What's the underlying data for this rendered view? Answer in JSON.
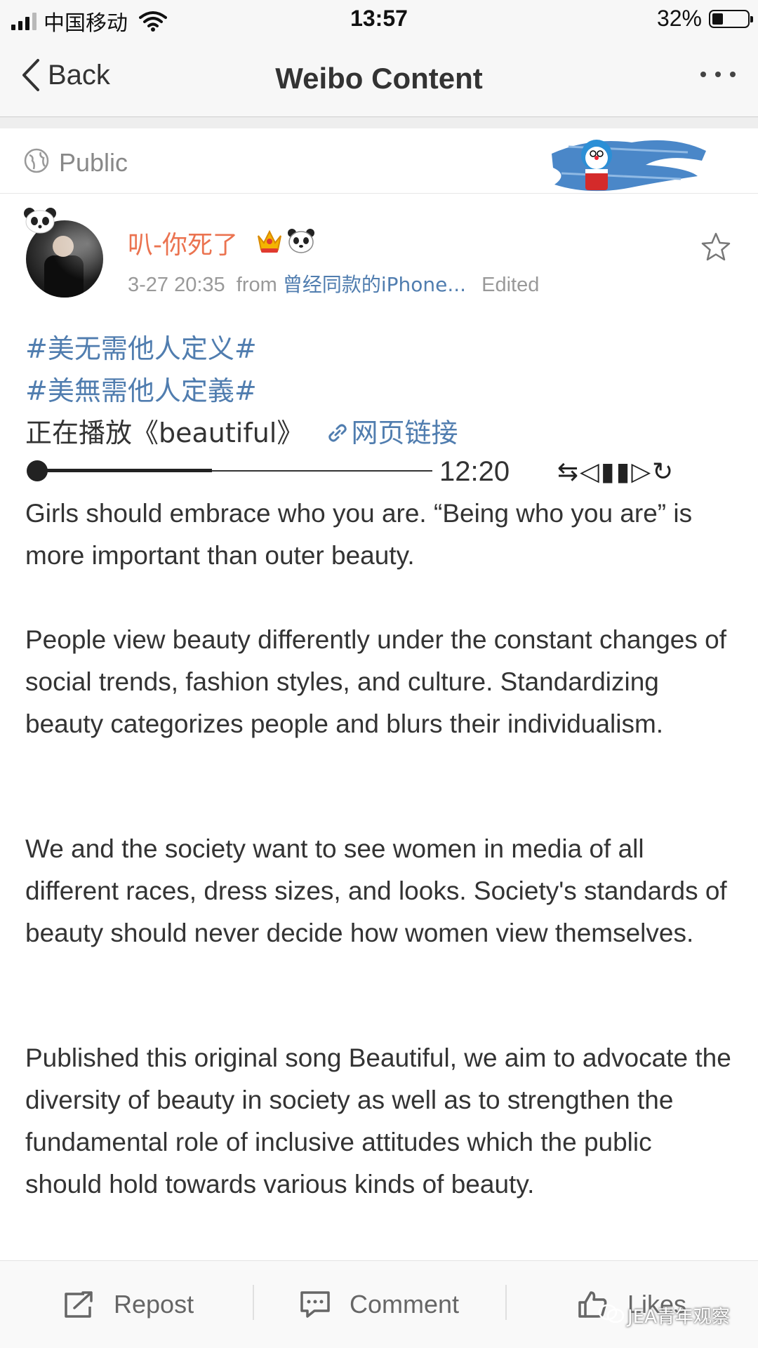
{
  "status_bar": {
    "carrier": "中国移动",
    "time": "13:57",
    "battery_percent": "32%",
    "battery_level": 0.32
  },
  "nav": {
    "back_label": "Back",
    "title": "Weibo Content"
  },
  "visibility": {
    "label": "Public"
  },
  "post": {
    "author": "叭-你死了",
    "timestamp": "3-27 20:35",
    "from_label": "from",
    "source": "曾经同款的iPhone...",
    "edited": "Edited",
    "topics": [
      "#美无需他人定义#",
      "#美無需他人定義#"
    ],
    "now_playing": "正在播放《beautiful》",
    "link_label": "网页链接",
    "player": {
      "time": "12:20",
      "progress": 0.44,
      "controls": "⇆◁▮▮▷↻"
    },
    "paragraphs": [
      "Girls should embrace who you are.  “Being who you are” is more important than outer beauty.",
      "People view beauty differently under the constant changes of social trends, fashion styles, and culture. Standardizing beauty categorizes people and blurs their individualism.",
      "We and the society want to see women in media of all different races, dress sizes, and looks. Society's standards of beauty should never decide how women view themselves.",
      "Published this original song Beautiful, we aim to advocate the diversity of beauty in society as well as to strengthen the fundamental role of inclusive attitudes which the public should hold towards various kinds of beauty."
    ]
  },
  "actions": {
    "repost": "Repost",
    "comment": "Comment",
    "likes": "Likes"
  },
  "watermark": "JEA青年观察",
  "colors": {
    "link": "#507daf",
    "username": "#eb7350",
    "text": "#333333"
  }
}
